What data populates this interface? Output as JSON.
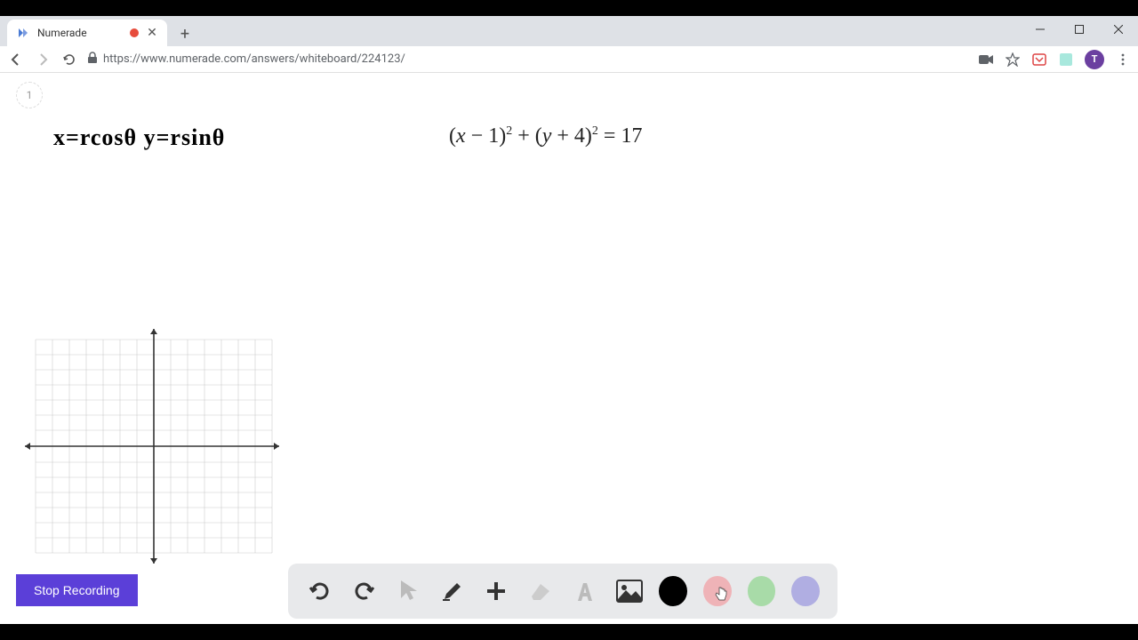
{
  "browser": {
    "tab_title": "Numerade",
    "url": "https://www.numerade.com/answers/whiteboard/224123/",
    "avatar_letter": "T"
  },
  "whiteboard": {
    "page_number": "1",
    "handwritten_text": "x=rcosθ   y=rsinθ",
    "equation": "(x − 1)² + (y + 4)² = 17"
  },
  "controls": {
    "stop_recording_label": "Stop Recording"
  },
  "colors": {
    "black": "#000000",
    "pink": "#efb3b7",
    "green": "#a8dba8",
    "purple": "#b0aee2"
  }
}
